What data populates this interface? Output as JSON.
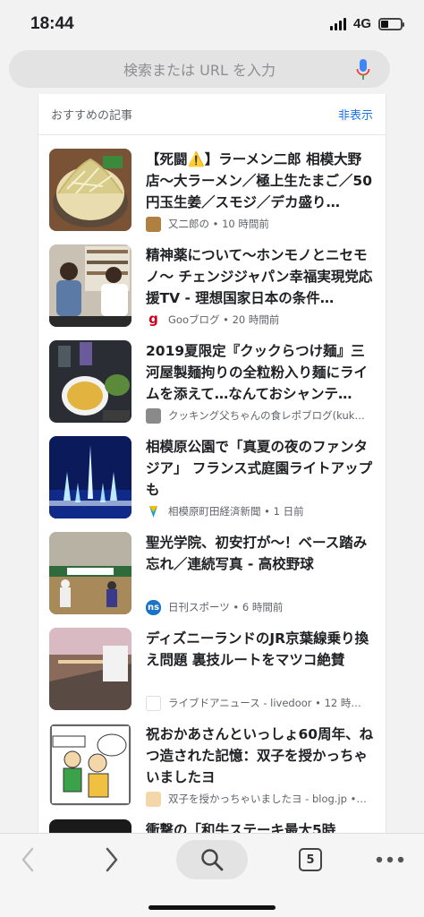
{
  "status_bar": {
    "time": "18:44",
    "network": "4G"
  },
  "search": {
    "placeholder": "検索または URL を入力"
  },
  "section": {
    "title": "おすすめの記事",
    "hide_label": "非表示"
  },
  "articles": [
    {
      "title": "【死闘⚠️】ラーメン二郎 相模大野店〜大ラーメン／極上生たまご／50円玉生姜／スモジ／デカ盛り…",
      "meta": "又二郎の • 10 時間前"
    },
    {
      "title": "精神薬について〜ホンモノとニセモノ〜 チェンジジャパン幸福実現党応援TV - 理想国家日本の条件…",
      "meta": "Gooブログ • 20 時間前"
    },
    {
      "title": "2019夏限定『クックらつけ麺』三河屋製麺拘りの全粒粉入り麺にライムを添えて…なんておシャンテ…",
      "meta": "クッキング父ちゃんの食レポブログ(kuk…"
    },
    {
      "title": "相模原公園で「真夏の夜のファンタジア」 フランス式庭園ライトアップも",
      "meta": "相模原町田経済新聞 • 1 日前"
    },
    {
      "title": "聖光学院、初安打が〜！ベース踏み忘れ／連続写真 - 高校野球",
      "meta": "日刊スポーツ • 6 時間前"
    },
    {
      "title": "ディズニーランドのJR京葉線乗り換え問題 裏技ルートをマツコ絶賛",
      "meta": "ライブドアニュース - livedoor • 12 時…"
    },
    {
      "title": "祝おかあさんといっしょ60周年、ねつ造された記憶：双子を授かっちゃいましたヨ",
      "meta": "双子を授かっちゃいましたヨ - blog.jp •…"
    },
    {
      "title": "衝撃の「和牛ステーキ最大5時",
      "meta": ""
    }
  ],
  "toolbar": {
    "tab_count": "5"
  },
  "colors": {
    "accent": "#1a73e8",
    "mic_blue": "#4285f4",
    "mic_red": "#ea4335"
  }
}
